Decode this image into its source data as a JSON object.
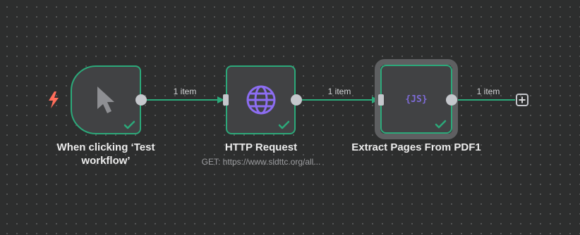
{
  "nodes": [
    {
      "id": "manual-trigger",
      "title": "When clicking ‘Test workflow’",
      "subtitle": "",
      "icon": "cursor-icon",
      "status": "success"
    },
    {
      "id": "http-request",
      "title": "HTTP Request",
      "subtitle": "GET: https://www.sldttc.org/all...",
      "icon": "globe-icon",
      "status": "success"
    },
    {
      "id": "extract-pages",
      "title": "Extract Pages From PDF1",
      "subtitle": "",
      "icon": "js-icon",
      "icon_text": "{JS}",
      "status": "success",
      "selected": true
    }
  ],
  "edges": [
    {
      "from": "manual-trigger",
      "to": "http-request",
      "label": "1 item"
    },
    {
      "from": "http-request",
      "to": "extract-pages",
      "label": "1 item"
    },
    {
      "from": "extract-pages",
      "to": "add-node",
      "label": "1 item"
    }
  ],
  "add_node": {
    "icon": "plus-icon",
    "label": "+"
  },
  "colors": {
    "canvas": "#2d2e2e",
    "node_fill": "#414244",
    "success": "#2ca97a",
    "trigger_bolt": "#ff6d5a",
    "globe": "#8c6df2",
    "js": "#7d6bd6",
    "handle": "#c5c7cc"
  }
}
